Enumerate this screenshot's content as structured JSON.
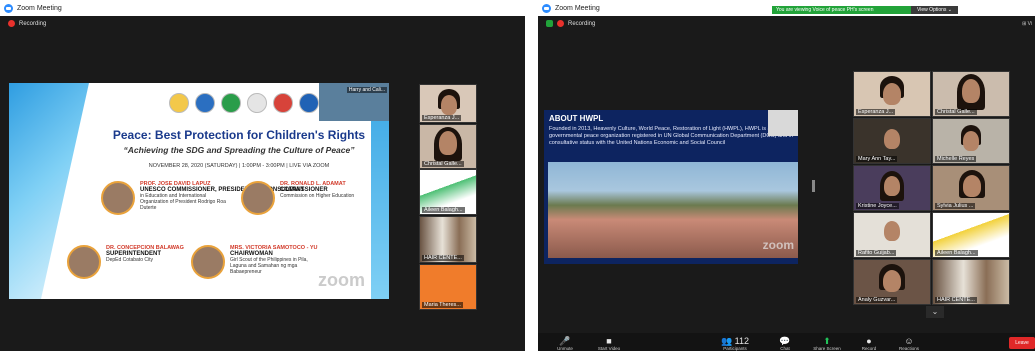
{
  "window1": {
    "title": "Zoom Meeting",
    "recording": "Recording",
    "slide": {
      "title": "Peace: Best Protection for Children's Rights",
      "subtitle": "“Achieving the SDG and Spreading the Culture of Peace”",
      "date": "NOVEMBER 28, 2020 (SATURDAY) | 1:00PM - 3:00PM | LIVE VIA ZOOM",
      "presenter_label": "Harry and Cali...",
      "watermark": "zoom",
      "speakers": [
        {
          "name": "PROF. JOSE DAVID LAPUZ",
          "role": "UNESCO COMMISSIONER, PRESIDENTIAL CONSULTANT",
          "desc": "in Education and International Organization of President Rodrigo Roa Duterte"
        },
        {
          "name": "DR. RONALD L. ADAMAT",
          "role": "COMMISSIONER",
          "desc": "Commission on Higher Education"
        },
        {
          "name": "DR. CONCEPCION BALAWAG",
          "role": "SUPERINTENDENT",
          "desc": "DepEd Cotabato City"
        },
        {
          "name": "MRS. VICTORIA SAMOTOCO - YU",
          "role": "CHAIRWOMAN",
          "desc": "Girl Scout of the Philippines in Pila, Laguna and Samahan ng mga Babaepreneur"
        }
      ]
    },
    "thumbs": [
      "Esperanza J...",
      "Christal Galle...",
      "Aileen Balagh...",
      "HAIR CENTE...",
      "Maria Theres..."
    ]
  },
  "window2": {
    "title": "Zoom Meeting",
    "recording": "Recording",
    "banner": "You are viewing Voice of peace PH's screen",
    "view_options": "View Options ⌄",
    "share": {
      "title": "ABOUT HWPL",
      "body": "Founded in 2013, Heavenly Culture, World Peace, Restoration of Light (HWPL), HWPL is a non-governmental peace organization registered in UN Global Communication Department (DGC) and in consultative status with the United Nations Economic and Social Council",
      "watermark": "zoom"
    },
    "participants": [
      "Esperanza J...",
      "Christal Galle...",
      "Mary Ann Tay...",
      "Michelle Reyes",
      "Kristine Joyce...",
      "Sylvia Julius ...",
      "Rafito Guijab...",
      "Aileen Balagh...",
      "Analy Guzvar...",
      "HAIR CENTE..."
    ],
    "toolbar": [
      {
        "label": "Unmute",
        "icon": "🎤"
      },
      {
        "label": "Start Video",
        "icon": "■"
      },
      {
        "label": "Participants",
        "icon": "👥 112"
      },
      {
        "label": "Chat",
        "icon": "💬"
      },
      {
        "label": "Share Screen",
        "icon": "⬆"
      },
      {
        "label": "Record",
        "icon": "●"
      },
      {
        "label": "Reactions",
        "icon": "☺"
      }
    ],
    "leave": "Leave",
    "view_btn": "⊞ Vi"
  }
}
